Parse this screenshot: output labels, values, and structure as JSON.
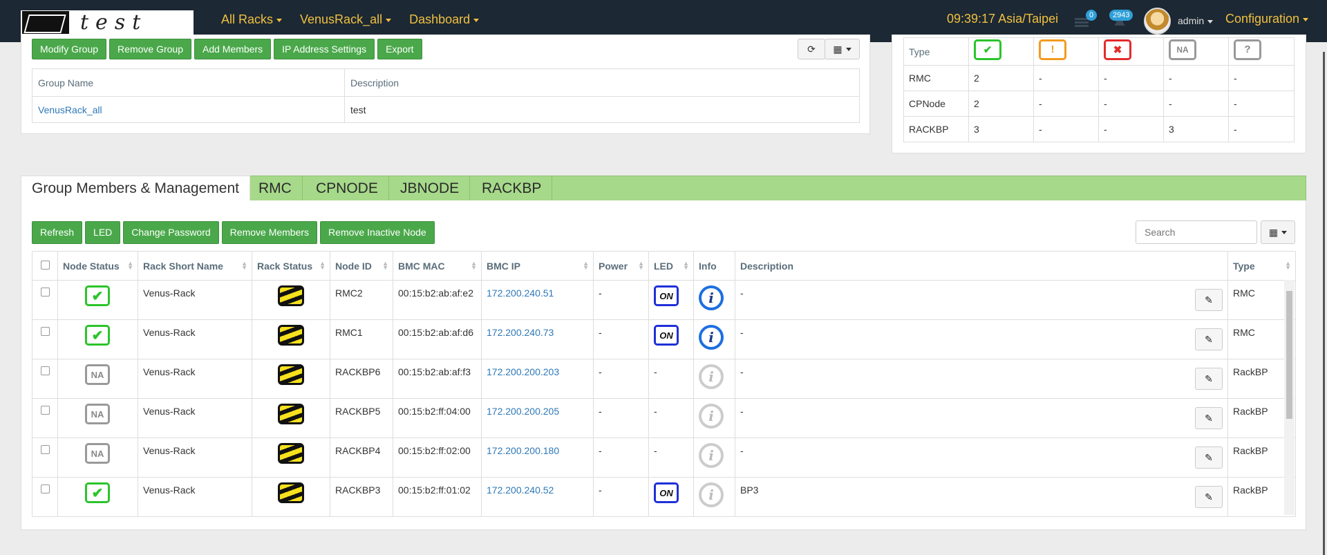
{
  "nav": {
    "logo_text": "test",
    "menus": [
      "All Racks",
      "VenusRack_all",
      "Dashboard"
    ],
    "clock": "09:39:17 Asia/Taipei",
    "tasks_badge": "0",
    "alerts_badge": "2943",
    "user": "admin",
    "configuration": "Configuration"
  },
  "group": {
    "buttons": [
      "Modify Group",
      "Remove Group",
      "Add Members",
      "IP Address Settings",
      "Export"
    ],
    "headers": [
      "Group Name",
      "Description"
    ],
    "row": {
      "name": "VenusRack_all",
      "description": "test"
    }
  },
  "summary": {
    "type_label": "Type",
    "status_icons": [
      "ok",
      "warning",
      "error",
      "na",
      "unknown"
    ],
    "rows": [
      {
        "type": "RMC",
        "values": [
          "2",
          "-",
          "-",
          "-",
          "-"
        ]
      },
      {
        "type": "CPNode",
        "values": [
          "2",
          "-",
          "-",
          "-",
          "-"
        ]
      },
      {
        "type": "RACKBP",
        "values": [
          "3",
          "-",
          "-",
          "3",
          "-"
        ]
      }
    ]
  },
  "tabs": [
    "Group Members & Management",
    "RMC",
    "CPNODE",
    "JBNODE",
    "RACKBP"
  ],
  "toolbar": {
    "buttons": [
      "Refresh",
      "LED",
      "Change Password",
      "Remove Members",
      "Remove Inactive Node"
    ],
    "search_placeholder": "Search"
  },
  "members": {
    "columns": [
      "Node Status",
      "Rack Short Name",
      "Rack Status",
      "Node ID",
      "BMC MAC",
      "BMC IP",
      "Power",
      "LED",
      "Info",
      "Description",
      "Type"
    ],
    "rows": [
      {
        "status": "ok",
        "rack": "Venus-Rack",
        "node_id": "RMC2",
        "mac": "00:15:b2:ab:af:e2",
        "ip": "172.200.240.51",
        "power": "-",
        "led": "ON",
        "info": "on",
        "description": "-",
        "type": "RMC"
      },
      {
        "status": "ok",
        "rack": "Venus-Rack",
        "node_id": "RMC1",
        "mac": "00:15:b2:ab:af:d6",
        "ip": "172.200.240.73",
        "power": "-",
        "led": "ON",
        "info": "on",
        "description": "-",
        "type": "RMC"
      },
      {
        "status": "na",
        "rack": "Venus-Rack",
        "node_id": "RACKBP6",
        "mac": "00:15:b2:ab:af:f3",
        "ip": "172.200.200.203",
        "power": "-",
        "led": "-",
        "info": "off",
        "description": "-",
        "type": "RackBP"
      },
      {
        "status": "na",
        "rack": "Venus-Rack",
        "node_id": "RACKBP5",
        "mac": "00:15:b2:ff:04:00",
        "ip": "172.200.200.205",
        "power": "-",
        "led": "-",
        "info": "off",
        "description": "-",
        "type": "RackBP"
      },
      {
        "status": "na",
        "rack": "Venus-Rack",
        "node_id": "RACKBP4",
        "mac": "00:15:b2:ff:02:00",
        "ip": "172.200.200.180",
        "power": "-",
        "led": "-",
        "info": "off",
        "description": "-",
        "type": "RackBP"
      },
      {
        "status": "ok",
        "rack": "Venus-Rack",
        "node_id": "RACKBP3",
        "mac": "00:15:b2:ff:01:02",
        "ip": "172.200.240.52",
        "power": "-",
        "led": "ON",
        "info": "off",
        "description": "BP3",
        "type": "RackBP"
      }
    ]
  },
  "colors": {
    "nav_bg": "#1c2833",
    "nav_accent": "#f0c040",
    "button_green": "#4aa84a",
    "tab_green": "#a6d98a",
    "link": "#2e78b8"
  }
}
